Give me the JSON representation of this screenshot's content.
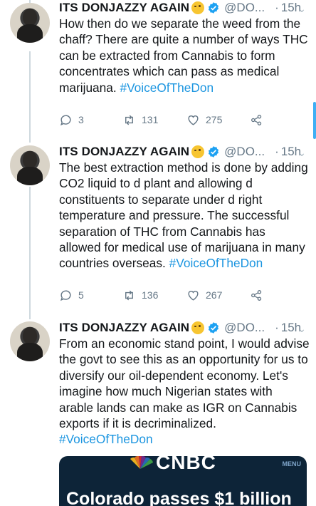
{
  "tweets": [
    {
      "name": "ITS DONJAZZY AGAIN",
      "handle": "@DO...",
      "dot": "·",
      "time": "15h",
      "text": "How then do we separate the weed from the chaff? There are quite a number of ways THC can be extracted from Cannabis to form concentrates which can pass as medical marijuana. ",
      "hashtag": "#VoiceOfTheDon",
      "replies": "3",
      "retweets": "131",
      "likes": "275"
    },
    {
      "name": "ITS DONJAZZY AGAIN",
      "handle": "@DO...",
      "dot": "·",
      "time": "15h",
      "text": "The best extraction method is done by adding CO2 liquid to d plant and allowing d constituents to separate under d right temperature and pressure. The successful separation of THC from Cannabis has allowed for medical use of marijuana in many countries overseas. ",
      "hashtag": "#VoiceOfTheDon",
      "replies": "5",
      "retweets": "136",
      "likes": "267"
    },
    {
      "name": "ITS DONJAZZY AGAIN",
      "handle": "@DO...",
      "dot": "·",
      "time": "15h",
      "text": "From an economic stand point, I would advise the govt to see this as an opportunity for us to diversify our oil-dependent economy. Let's imagine how much Nigerian states with arable lands can make as IGR on Cannabis exports if it is decriminalized. ",
      "hashtag": "#VoiceOfTheDon"
    }
  ],
  "card": {
    "brand": "CNBC",
    "menu": "MENU",
    "headline": "Colorado passes $1 billion"
  },
  "colors": {
    "accent": "#1da1f2",
    "hashtag": "#1b95e0",
    "muted": "#657786",
    "card_bg": "#0d2438"
  },
  "icons": {
    "reply": "speech-bubble-icon",
    "retweet": "retweet-arrows-icon",
    "like": "heart-icon",
    "share": "share-nodes-icon",
    "verified": "verified-badge-icon",
    "caret": "chevron-down-icon"
  }
}
